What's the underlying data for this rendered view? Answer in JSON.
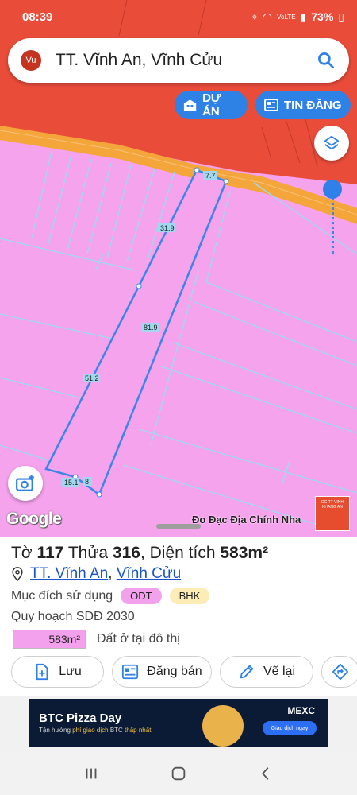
{
  "status": {
    "time": "08:39",
    "network": "VoLTE",
    "battery": "73%"
  },
  "search": {
    "avatar": "Vu",
    "title": "TT. Vĩnh An, Vĩnh Cửu"
  },
  "buttons": {
    "du_an": "DỰ ÁN",
    "tin_dang": "TIN ĐĂNG"
  },
  "map": {
    "edge_labels": [
      "7.7",
      "31.9",
      "81.9",
      "51.2",
      "15.1",
      "8"
    ],
    "google": "Google",
    "watermark": "Đo Đạc Địa Chính Nha",
    "brand": "ĐC TT VINH KHANG AN"
  },
  "parcel": {
    "to_label": "Tờ",
    "to_value": "117",
    "thua_label": "Thửa",
    "thua_value": "316",
    "area_label": "Diện tích",
    "area_value": "583m²",
    "location_town": "TT. Vĩnh An",
    "location_district": "Vĩnh Cửu",
    "purpose_label": "Mục đích sử dụng",
    "purpose_badges": [
      "ODT",
      "BHK"
    ],
    "plan_label": "Quy hoạch SDĐ 2030",
    "plan_area": "583m²",
    "plan_desc": "Đất ở tại đô thị"
  },
  "actions": {
    "save": "Lưu",
    "sell": "Đăng bán",
    "redraw": "Vẽ lại"
  },
  "ad": {
    "title": "BTC Pizza Day",
    "sub_prefix": "Tận hưởng",
    "sub_highlight": "phí giao dịch",
    "sub_mid": "BTC",
    "sub_suffix": "thấp nhất",
    "brand": "MEXC",
    "cta": "Giao dịch ngay"
  },
  "colors": {
    "map_residential": "#f5a3ec",
    "map_red": "#ea4c3a",
    "road": "#f4a63a",
    "accent": "#2e82e6",
    "parcel_line": "#3b86e6"
  }
}
